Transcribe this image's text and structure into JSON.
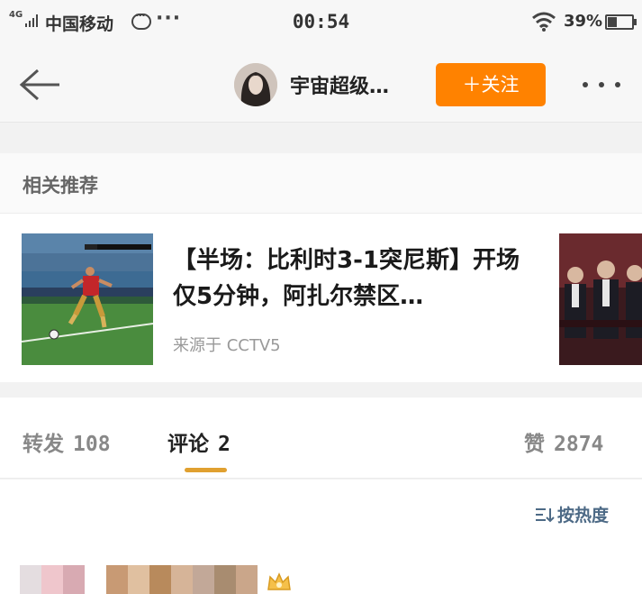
{
  "status_bar": {
    "network": "4G",
    "carrier": "中国移动",
    "time": "00:54",
    "battery_percent": "39%",
    "battery_level": 0.39,
    "icons": [
      "signal-icon",
      "chat-bubble-icon",
      "more-dots-icon",
      "wifi-icon",
      "battery-icon"
    ]
  },
  "nav": {
    "back_icon": "back-arrow-icon",
    "username": "宇宙超级…",
    "follow_label": "＋关注",
    "more_icon": "more-icon",
    "accent_color": "#ff8200"
  },
  "recommendations": {
    "section_title": "相关推荐",
    "card": {
      "headline": "【半场：比利时3-1突尼斯】开场仅5分钟，阿扎尔禁区…",
      "source": "来源于 CCTV5"
    }
  },
  "tabs": [
    {
      "label": "转发",
      "count": "108",
      "active": false
    },
    {
      "label": "评论",
      "count": "2",
      "active": true
    },
    {
      "label": "赞",
      "count": "2874",
      "active": false
    }
  ],
  "comments": {
    "sort_label": "按热度",
    "sort_color": "#4d6a86"
  }
}
